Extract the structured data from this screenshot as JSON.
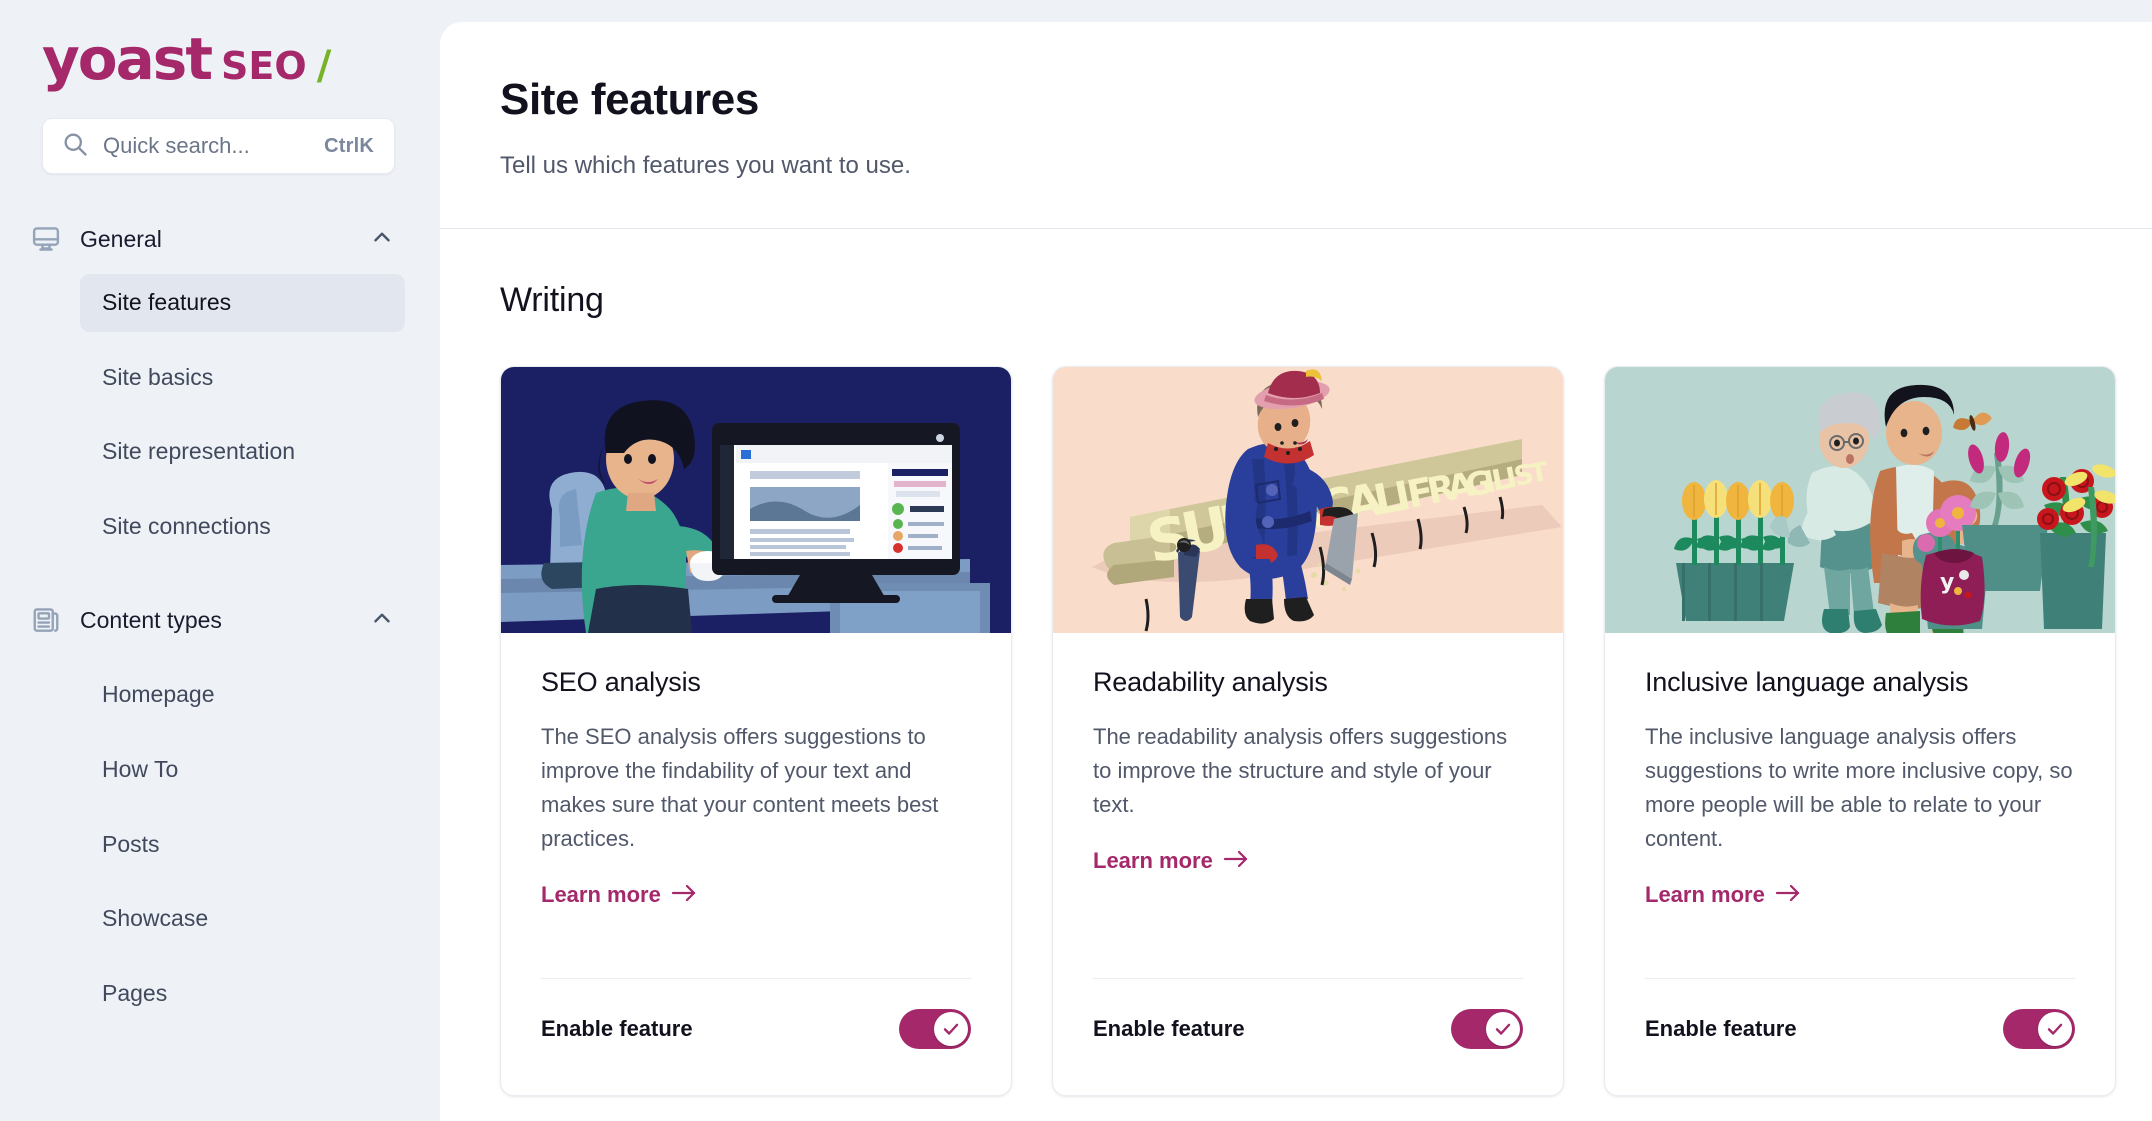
{
  "brand": {
    "name": "yoast",
    "product": "SEO",
    "slash": "/",
    "primary_color": "#a4286a",
    "accent_color": "#77b227"
  },
  "search": {
    "placeholder": "Quick search...",
    "shortcut": "CtrlK",
    "icon": "search-icon"
  },
  "sidebar": {
    "groups": [
      {
        "label": "General",
        "icon": "monitor-icon",
        "expanded": true,
        "items": [
          {
            "label": "Site features",
            "active": true
          },
          {
            "label": "Site basics",
            "active": false
          },
          {
            "label": "Site representation",
            "active": false
          },
          {
            "label": "Site connections",
            "active": false
          }
        ]
      },
      {
        "label": "Content types",
        "icon": "article-icon",
        "expanded": true,
        "items": [
          {
            "label": "Homepage",
            "active": false
          },
          {
            "label": "How To",
            "active": false
          },
          {
            "label": "Posts",
            "active": false
          },
          {
            "label": "Showcase",
            "active": false
          },
          {
            "label": "Pages",
            "active": false
          }
        ]
      }
    ]
  },
  "header": {
    "title": "Site features",
    "subtitle": "Tell us which features you want to use."
  },
  "sections": [
    {
      "title": "Writing",
      "cards": [
        {
          "title": "SEO analysis",
          "description": "The SEO analysis offers suggestions to improve the findability of your text and makes sure that your content meets best practices.",
          "learn_more": "Learn more",
          "enable_label": "Enable feature",
          "enabled": true,
          "illustration": "woman-at-desk-with-monitor",
          "illustration_bg": "#1b1f63"
        },
        {
          "title": "Readability analysis",
          "description": "The readability analysis offers suggestions to improve the structure and style of your text.",
          "learn_more": "Learn more",
          "enable_label": "Enable feature",
          "enabled": true,
          "illustration": "woman-sawing-long-word",
          "illustration_bg": "#f9dcca"
        },
        {
          "title": "Inclusive language analysis",
          "description": "The inclusive language analysis offers suggestions to write more inclusive copy, so more people will be able to relate to your content.",
          "learn_more": "Learn more",
          "enable_label": "Enable feature",
          "enabled": true,
          "illustration": "two-people-gardening",
          "illustration_bg": "#b9d5cf"
        }
      ]
    }
  ]
}
